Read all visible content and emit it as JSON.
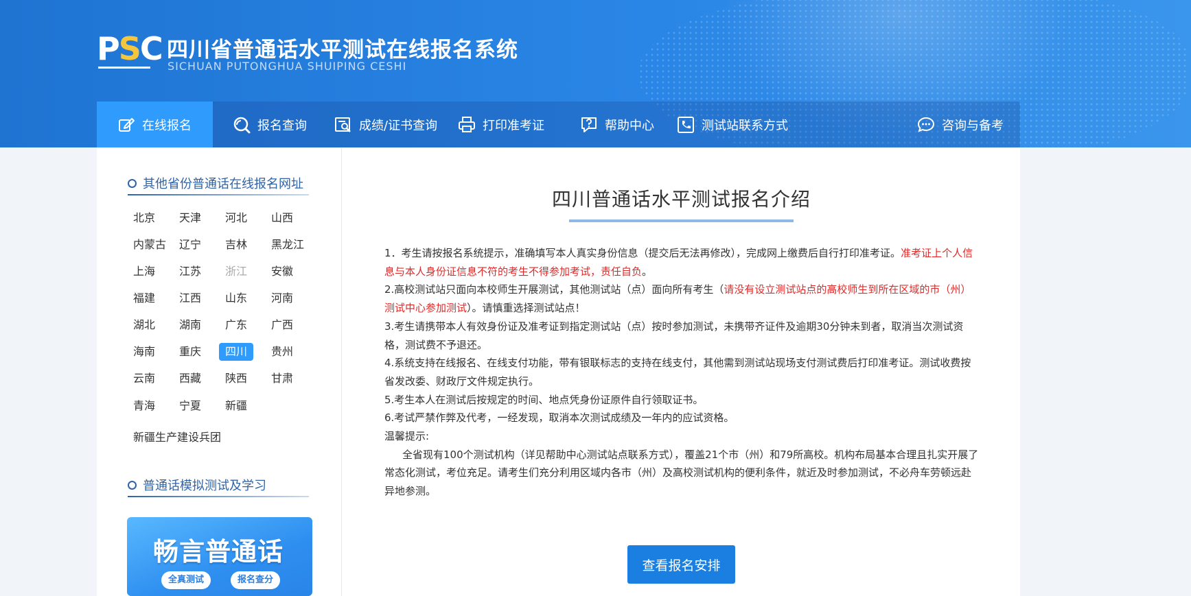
{
  "header": {
    "logo_text": "PSC",
    "title": "四川省普通话水平测试在线报名系统",
    "subtitle": "SICHUAN PUTONGHUA SHUIPING CESHI"
  },
  "nav": {
    "items": [
      {
        "label": "在线报名",
        "icon": "edit-icon",
        "active": true
      },
      {
        "label": "报名查询",
        "icon": "search-icon",
        "active": false
      },
      {
        "label": "成绩/证书查询",
        "icon": "certificate-search-icon",
        "active": false
      },
      {
        "label": "打印准考证",
        "icon": "printer-icon",
        "active": false
      },
      {
        "label": "帮助中心",
        "icon": "help-icon",
        "active": false
      },
      {
        "label": "测试站联系方式",
        "icon": "phone-icon",
        "active": false
      },
      {
        "label": "咨询与备考",
        "icon": "chat-icon",
        "active": false
      }
    ]
  },
  "sidebar": {
    "provinces_title": "其他省份普通话在线报名网址",
    "provinces": [
      "北京",
      "天津",
      "河北",
      "山西",
      "内蒙古",
      "辽宁",
      "吉林",
      "黑龙江",
      "上海",
      "江苏",
      "浙江",
      "安徽",
      "福建",
      "江西",
      "山东",
      "河南",
      "湖北",
      "湖南",
      "广东",
      "广西",
      "海南",
      "重庆",
      "四川",
      "贵州",
      "云南",
      "西藏",
      "陕西",
      "甘肃",
      "青海",
      "宁夏",
      "新疆"
    ],
    "active_province": "四川",
    "disabled_province": "浙江",
    "extra_link": "新疆生产建设兵团",
    "practice_title": "普通话模拟测试及学习",
    "promo": {
      "title": "畅言普通话",
      "pill1": "全真测试",
      "pill2": "报名查分"
    }
  },
  "main": {
    "title": "四川普通话水平测试报名介绍",
    "items": {
      "i1_a": "1．考生请按报名系统提示，准确填写本人真实身份信息（提交后无法再修改），完成网上缴费后自行打印准考证。",
      "i1_b": "准考证上个人信息与本人身份证信息不符的考生不得参加考试，责任自负",
      "i1_c": "。",
      "i2_a": "2.高校测试站只面向本校师生开展测试，其他测试站（点）面向所有考生（",
      "i2_b": "请没有设立测试站点的高校师生到所在区域的市（州）测试中心参加测试",
      "i2_c": "）。请慎重选择测试站点！",
      "i3": "3.考生请携带本人有效身份证及准考证到指定测试站（点）按时参加测试，未携带齐证件及逾期30分钟未到者，取消当次测试资格，测试费不予退还。",
      "i4": "4.系统支持在线报名、在线支付功能，带有银联标志的支持在线支付，其他需到测试站现场支付测试费后打印准考证。测试收费按省发改委、财政厅文件规定执行。",
      "i5": "5.考生本人在测试后按规定的时间、地点凭身份证原件自行领取证书。",
      "i6": "6.考试严禁作弊及代考，一经发现，取消本次测试成绩及一年内的应试资格。",
      "tip_label": "温馨提示:",
      "tip_body": "全省现有100个测试机构（详见帮助中心测试站点联系方式），覆盖21个市（州）和79所高校。机构布局基本合理且扎实开展了常态化测试，考位充足。请考生们充分利用区域内各市（州）及高校测试机构的便利条件，就近及时参加测试，不必舟车劳顿远赴异地参测。"
    },
    "cta_label": "查看报名安排"
  },
  "colors": {
    "header_blue": "#2a86e6",
    "active_blue": "#2e9bfd",
    "button_blue": "#1a7fe0",
    "warning_red": "#e02a2a",
    "section_blue": "#2f63a8"
  }
}
